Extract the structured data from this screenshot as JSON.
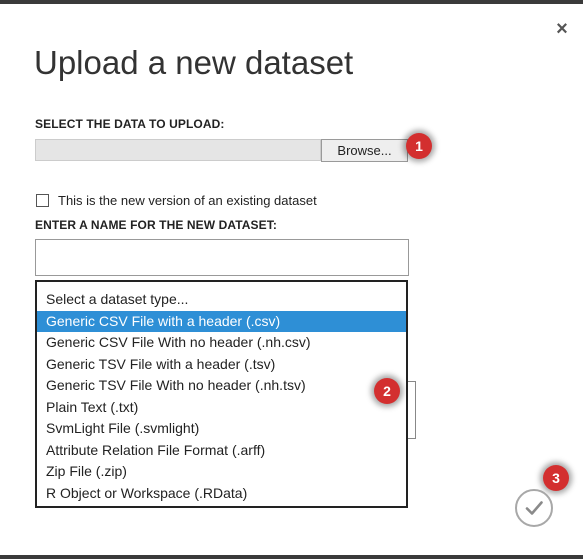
{
  "dialog": {
    "title": "Upload a new dataset",
    "close_glyph": "×"
  },
  "upload_section": {
    "label": "SELECT THE DATA TO UPLOAD:",
    "file_path_value": "",
    "browse_label": "Browse..."
  },
  "new_version": {
    "checked": false,
    "label": "This is the new version of an existing dataset"
  },
  "name_section": {
    "label": "ENTER A NAME FOR THE NEW DATASET:",
    "value": ""
  },
  "dataset_type_dropdown": {
    "options": [
      "Select a dataset type...",
      "Generic CSV File with a header (.csv)",
      "Generic CSV File With no header (.nh.csv)",
      "Generic TSV File with a header (.tsv)",
      "Generic TSV File With no header (.nh.tsv)",
      "Plain Text (.txt)",
      "SvmLight File (.svmlight)",
      "Attribute Relation File Format (.arff)",
      "Zip File (.zip)",
      "R Object or Workspace (.RData)"
    ],
    "highlighted_option": "Generic CSV File with a header (.csv)"
  },
  "step_badges": [
    "1",
    "2",
    "3"
  ],
  "icons": {
    "close": "close-icon",
    "ok": "checkmark-icon"
  },
  "colors": {
    "highlight": "#2e8fd6",
    "badge": "#d32f2f",
    "ok_ring": "#a8a8a8",
    "frame_bar": "#3a3a3a"
  }
}
